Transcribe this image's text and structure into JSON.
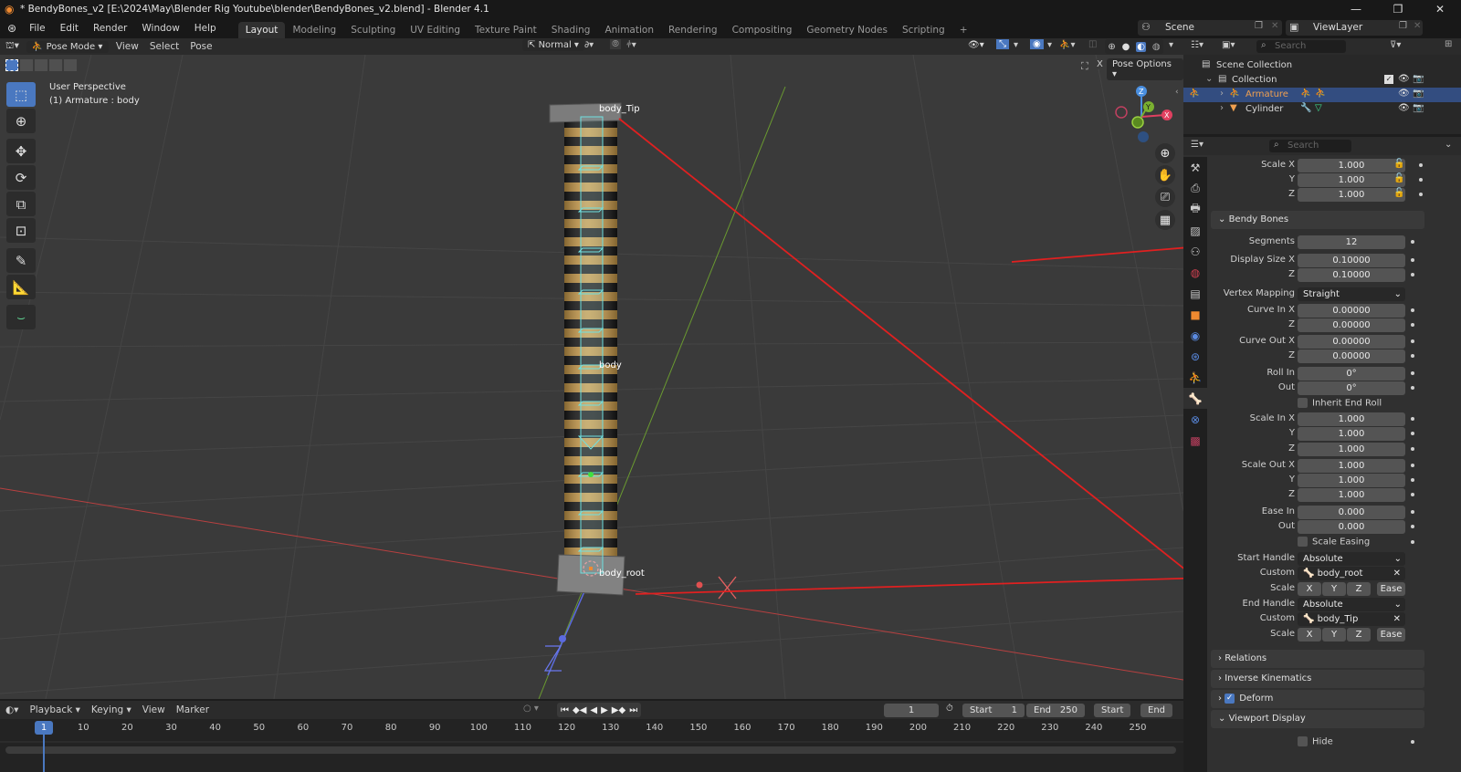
{
  "window": {
    "title": "* BendyBones_v2 [E:\\2024\\May\\Blender Rig Youtube\\blender\\BendyBones_v2.blend] - Blender 4.1",
    "controls": [
      "minimize",
      "maximize",
      "close"
    ]
  },
  "menubar": {
    "items": [
      "File",
      "Edit",
      "Render",
      "Window",
      "Help"
    ],
    "workspaces": [
      "Layout",
      "Modeling",
      "Sculpting",
      "UV Editing",
      "Texture Paint",
      "Shading",
      "Animation",
      "Rendering",
      "Compositing",
      "Geometry Nodes",
      "Scripting"
    ],
    "active_workspace": "Layout",
    "add_workspace": "+",
    "scene": "Scene",
    "view_layer": "ViewLayer"
  },
  "viewport_header": {
    "mode": "Pose Mode",
    "menus": [
      "View",
      "Select",
      "Pose"
    ],
    "transform_orientation": "Normal",
    "pose_options": "Pose Options",
    "x_mirror": "X"
  },
  "viewport": {
    "perspective": "User Perspective",
    "active_info": "(1) Armature : body",
    "bone_labels": [
      "body_Tip",
      "body",
      "body_root"
    ],
    "axis_gizmo": {
      "z": "Z",
      "y": "Y",
      "x": "X"
    },
    "tools": [
      "select-box",
      "cursor",
      "move",
      "rotate",
      "scale",
      "transform",
      "annotate",
      "measure",
      "relax"
    ]
  },
  "outliner": {
    "search_placeholder": "Search",
    "items": [
      {
        "label": "Scene Collection",
        "level": 0
      },
      {
        "label": "Collection",
        "level": 1
      },
      {
        "label": "Armature",
        "level": 2,
        "selected": true
      },
      {
        "label": "Cylinder",
        "level": 2,
        "selected": false
      }
    ]
  },
  "properties": {
    "search_placeholder": "Search",
    "scale": [
      {
        "label": "Scale X",
        "value": "1.000"
      },
      {
        "label": "Y",
        "value": "1.000"
      },
      {
        "label": "Z",
        "value": "1.000"
      }
    ],
    "bendy_bones": {
      "title": "Bendy Bones",
      "segments": {
        "label": "Segments",
        "value": "12"
      },
      "display_size_x": {
        "label": "Display Size X",
        "value": "0.10000"
      },
      "display_size_z": {
        "label": "Z",
        "value": "0.10000"
      },
      "vertex_mapping": {
        "label": "Vertex Mapping",
        "value": "Straight"
      },
      "curve_in_x": {
        "label": "Curve In X",
        "value": "0.00000"
      },
      "curve_in_z": {
        "label": "Z",
        "value": "0.00000"
      },
      "curve_out_x": {
        "label": "Curve Out X",
        "value": "0.00000"
      },
      "curve_out_z": {
        "label": "Z",
        "value": "0.00000"
      },
      "roll_in": {
        "label": "Roll In",
        "value": "0°"
      },
      "roll_out": {
        "label": "Out",
        "value": "0°"
      },
      "inherit_end_roll": {
        "label": "Inherit End Roll",
        "checked": false
      },
      "scale_in_x": {
        "label": "Scale In X",
        "value": "1.000"
      },
      "scale_in_y": {
        "label": "Y",
        "value": "1.000"
      },
      "scale_in_z": {
        "label": "Z",
        "value": "1.000"
      },
      "scale_out_x": {
        "label": "Scale Out X",
        "value": "1.000"
      },
      "scale_out_y": {
        "label": "Y",
        "value": "1.000"
      },
      "scale_out_z": {
        "label": "Z",
        "value": "1.000"
      },
      "ease_in": {
        "label": "Ease In",
        "value": "0.000"
      },
      "ease_out": {
        "label": "Out",
        "value": "0.000"
      },
      "scale_easing": {
        "label": "Scale Easing",
        "checked": false
      },
      "start_handle": {
        "label": "Start Handle",
        "value": "Absolute"
      },
      "start_custom": {
        "label": "Custom",
        "value": "body_root"
      },
      "start_scale": {
        "label": "Scale",
        "buttons": [
          "X",
          "Y",
          "Z",
          "Ease"
        ]
      },
      "end_handle": {
        "label": "End Handle",
        "value": "Absolute"
      },
      "end_custom": {
        "label": "Custom",
        "value": "body_Tip"
      },
      "end_scale": {
        "label": "Scale",
        "buttons": [
          "X",
          "Y",
          "Z",
          "Ease"
        ]
      }
    },
    "panels": [
      {
        "label": "Relations",
        "expanded": false
      },
      {
        "label": "Inverse Kinematics",
        "expanded": false
      },
      {
        "label": "Deform",
        "expanded": false,
        "checked": true
      },
      {
        "label": "Viewport Display",
        "expanded": true
      }
    ],
    "hide": {
      "label": "Hide",
      "checked": false
    }
  },
  "timeline": {
    "menus": [
      "Playback",
      "Keying",
      "View",
      "Marker"
    ],
    "current_frame": "1",
    "start_label": "Start",
    "start": "1",
    "end_label": "End",
    "end": "250",
    "start_btn": "Start",
    "end_btn": "End",
    "ticks": [
      "1",
      "10",
      "20",
      "30",
      "40",
      "50",
      "60",
      "70",
      "80",
      "90",
      "100",
      "110",
      "120",
      "130",
      "140",
      "150",
      "160",
      "170",
      "180",
      "190",
      "200",
      "210",
      "220",
      "230",
      "240",
      "250"
    ]
  },
  "colors": {
    "accent": "#4a78c0",
    "selected_text": "#f0a050",
    "annotation_arrow": "#e02020",
    "bone_wire": "#6fe0e0"
  }
}
